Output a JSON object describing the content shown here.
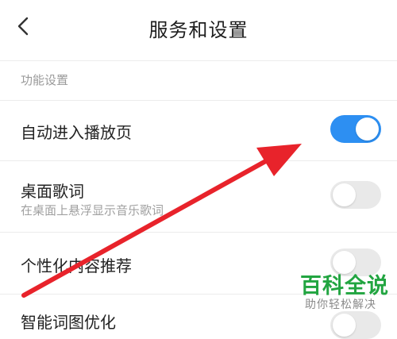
{
  "header": {
    "title": "服务和设置",
    "back_icon": "chevron-left-icon"
  },
  "section": {
    "label": "功能设置"
  },
  "settings": [
    {
      "title": "自动进入播放页",
      "subtitle": "",
      "enabled": true
    },
    {
      "title": "桌面歌词",
      "subtitle": "在桌面上悬浮显示音乐歌词",
      "enabled": false
    },
    {
      "title": "个性化内容推荐",
      "subtitle": "",
      "enabled": false
    },
    {
      "title": "智能词图优化",
      "subtitle": "",
      "enabled": false
    }
  ],
  "colors": {
    "accent": "#2d8ff2",
    "toggle_off": "#e9e9e9",
    "arrow": "#e8232b",
    "watermark": "#22a541"
  },
  "watermark": {
    "main": "百科全说",
    "sub": "助你轻松解决"
  }
}
